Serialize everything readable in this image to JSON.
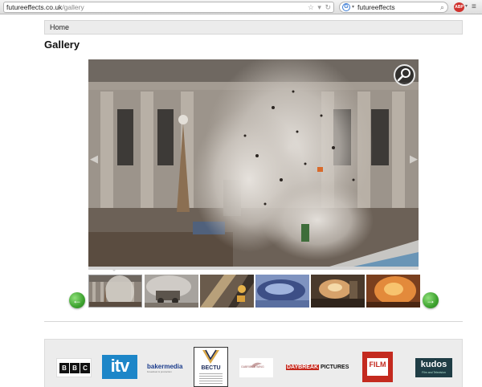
{
  "browser": {
    "url_domain": "futureeffects.co.uk",
    "url_path": "/gallery",
    "search_value": "futureeffects",
    "adblock_label": "ABP"
  },
  "nav": {
    "home_label": "Home"
  },
  "page": {
    "title": "Gallery"
  },
  "gallery": {
    "main_image": "explosion-at-colonnaded-building",
    "selected_index": 0,
    "thumbnails": [
      {
        "name": "explosion-at-building"
      },
      {
        "name": "vehicle-smoke"
      },
      {
        "name": "warm-light-abstract"
      },
      {
        "name": "blue-vehicle"
      },
      {
        "name": "fire-workshop"
      },
      {
        "name": "orange-glow"
      }
    ],
    "prev_icon": "arrow-left-icon",
    "next_icon": "arrow-right-icon",
    "zoom_icon": "magnifier-icon"
  },
  "logos": {
    "bbc": [
      "B",
      "B",
      "C"
    ],
    "itv": "itv",
    "baker_main": "bakermedia",
    "baker_sub": "broadcast & production",
    "bectu": "BECTU",
    "gabriel": "GABRIEL'S WING",
    "daybreak_a": "DAYBREAK",
    "daybreak_b": "PICTURES",
    "film": "FILM",
    "kudos": "kudos",
    "kudos_sub": "Film and Television"
  },
  "colors": {
    "itv_blue": "#1d86c8",
    "film_red": "#c42a1f",
    "arrow_green": "#3da22f",
    "kudos_teal": "#1f3d45"
  }
}
